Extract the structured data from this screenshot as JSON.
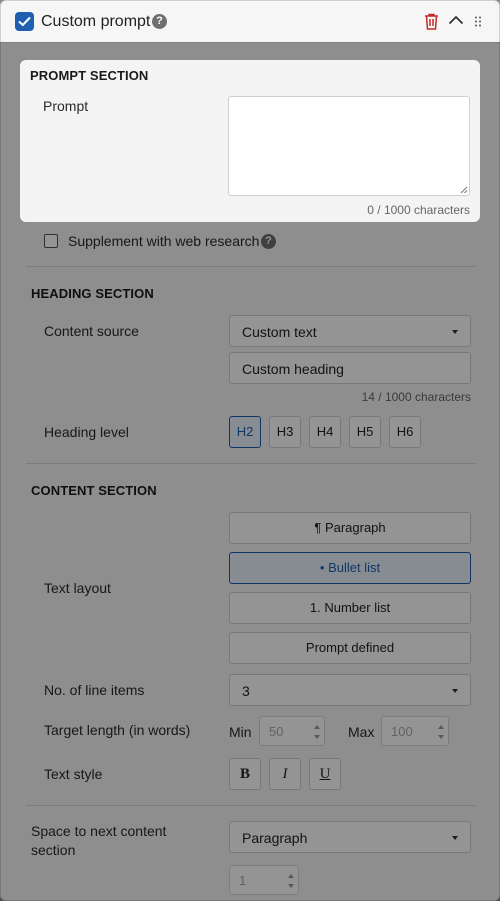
{
  "header": {
    "title": "Custom prompt"
  },
  "prompt_section": {
    "title": "PROMPT SECTION",
    "prompt_label": "Prompt",
    "prompt_value": "",
    "counter": "0 / 1000 characters",
    "web_research_label": "Supplement with web research"
  },
  "heading_section": {
    "title": "HEADING SECTION",
    "content_source_label": "Content source",
    "content_source_value": "Custom text",
    "heading_value": "Custom heading",
    "counter": "14 / 1000 characters",
    "heading_level_label": "Heading level",
    "levels": [
      "H2",
      "H3",
      "H4",
      "H5",
      "H6"
    ],
    "selected_level": "H2"
  },
  "content_section": {
    "title": "CONTENT SECTION",
    "text_layout_label": "Text layout",
    "layouts": [
      "¶ Paragraph",
      "• Bullet list",
      "1. Number list",
      "Prompt defined"
    ],
    "selected_layout": "• Bullet list",
    "line_items_label": "No. of line items",
    "line_items_value": "3",
    "target_length_label": "Target length (in words)",
    "min_label": "Min",
    "min_value": "50",
    "max_label": "Max",
    "max_value": "100",
    "text_style_label": "Text style",
    "styles": [
      "B",
      "I",
      "U"
    ]
  },
  "spacing": {
    "label_line1": "Space to next content",
    "label_line2": "section",
    "value": "Paragraph",
    "amount": "1"
  },
  "colors": {
    "accent": "#1f5fb0",
    "danger": "#c62828"
  }
}
